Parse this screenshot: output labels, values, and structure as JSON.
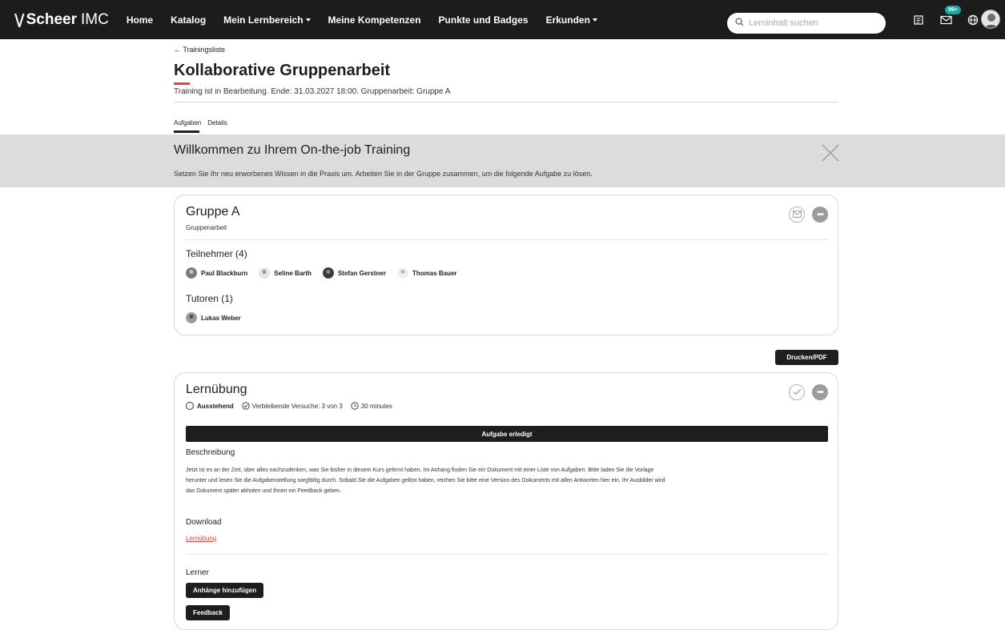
{
  "header": {
    "brand_mark": "\\/",
    "brand_name": "Scheer",
    "brand_sub": "IMC",
    "nav": [
      {
        "label": "Home"
      },
      {
        "label": "Katalog"
      },
      {
        "label": "Mein Lernbereich"
      },
      {
        "label": "Meine Kompetenzen"
      },
      {
        "label": "Punkte und Badges"
      },
      {
        "label": "Erkunden"
      }
    ],
    "search_placeholder": "Lerninhalt suchen",
    "messages_badge": "99+",
    "icons": [
      "book-icon",
      "envelope-icon",
      "globe-icon",
      "user-avatar"
    ]
  },
  "page": {
    "back_link": "← Trainingsliste",
    "title": "Kollaborative Gruppenarbeit",
    "subtitle": "Training ist in Bearbeitung. Ende: 31.03.2027 18:00. Gruppenarbeit: Gruppe A",
    "tabs": [
      {
        "label": "Aufgaben",
        "active": true
      },
      {
        "label": "Details",
        "active": false
      }
    ],
    "accent_color": "#e3453c"
  },
  "banner": {
    "title": "Willkommen zu Ihrem On-the-job Training",
    "text": "Setzen Sie Ihr neu erworbenes Wissen in die Praxis um. Arbeiten Sie in der Gruppe zusammen, um die folgende Aufgabe zu lösen."
  },
  "group_card": {
    "title": "Gruppe A",
    "subtitle": "Gruppenarbeit",
    "participants_label": "Teilnehmer (4)",
    "participants": [
      {
        "name": "Paul Blackburn"
      },
      {
        "name": "Seline Barth"
      },
      {
        "name": "Stefan Gerstner"
      },
      {
        "name": "Thomas Bauer"
      }
    ],
    "tutors_label": "Tutoren (1)",
    "tutors": [
      {
        "name": "Lukas Weber"
      }
    ]
  },
  "print_button": "Drucken/PDF",
  "task_card": {
    "title": "Lernübung",
    "status": "Ausstehend",
    "attempts": "Verbleibende Versuche: 3 von 3",
    "duration": "30 minutes",
    "done_button": "Aufgabe erledigt",
    "description_label": "Beschreibung",
    "description": "Jetzt ist es an der Zeit, über alles nachzudenken, was Sie bisher in diesem Kurs gelernt haben. Im Anhang finden Sie ein Dokument mit einer Liste von Aufgaben. Bitte laden Sie die Vorlage herunter und lesen Sie die Aufgabenstellung sorgfältig durch. Sobald Sie die Aufgaben gelöst haben, reichen Sie bitte eine Version des Dokuments mit allen Antworten hier ein. Ihr Ausbilder wird das Dokument später abholen und Ihnen ein Feedback geben.",
    "download_label": "Download",
    "download_link": "Lernübung",
    "learner_label": "Lerner",
    "attach_button": "Anhänge hinzufügen",
    "feedback_button": "Feedback"
  }
}
